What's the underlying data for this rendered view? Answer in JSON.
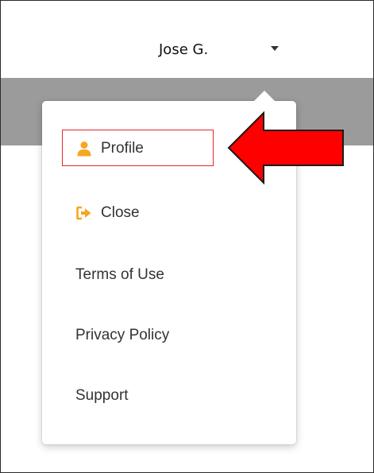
{
  "header": {
    "user_name": "Jose G."
  },
  "menu": {
    "items": [
      {
        "label": "Profile",
        "icon": "person-icon",
        "highlighted": true
      },
      {
        "label": "Close",
        "icon": "sign-out-icon"
      },
      {
        "label": "Terms of Use"
      },
      {
        "label": "Privacy Policy"
      },
      {
        "label": "Support"
      }
    ]
  },
  "colors": {
    "icon_accent": "#f5a623",
    "annotation_red": "#ff0000",
    "highlight_border": "#e4262e",
    "band_gray": "#9b9b9b"
  }
}
